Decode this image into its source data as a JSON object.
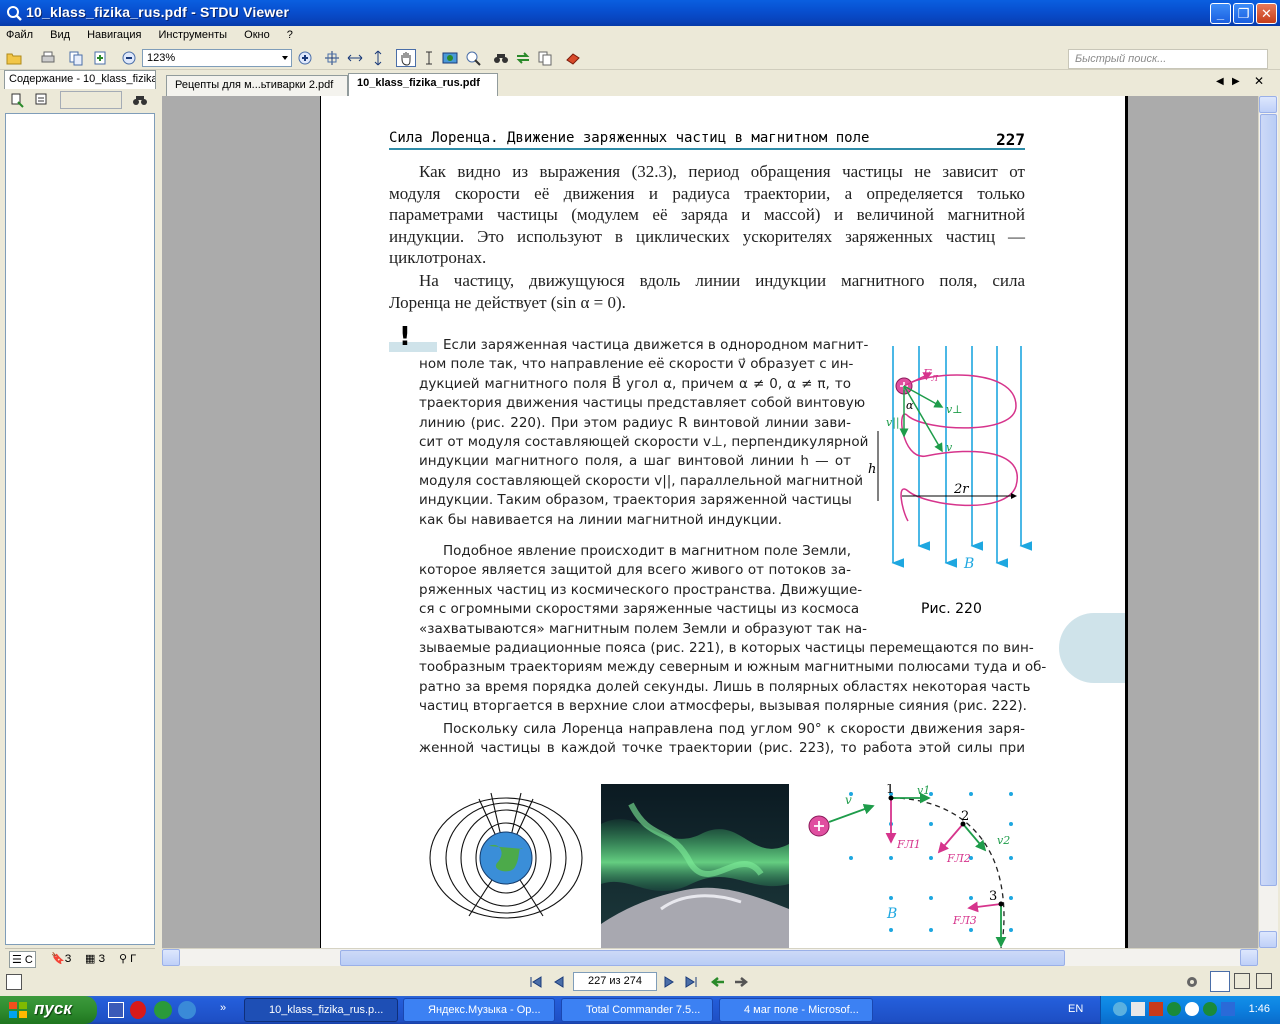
{
  "window": {
    "title": "10_klass_fizika_rus.pdf - STDU Viewer"
  },
  "menu": [
    "Файл",
    "Вид",
    "Навигация",
    "Инструменты",
    "Окно",
    "?"
  ],
  "toolbar": {
    "zoom": "123%",
    "search_placeholder": "Быстрый поиск..."
  },
  "sidebar": {
    "tab_label": "Содержание - 10_klass_fizika",
    "bottom_tabs": [
      "С",
      "З",
      "З",
      "Г"
    ]
  },
  "tabs": [
    {
      "label": "Рецепты для м...ьтиварки 2.pdf",
      "active": false
    },
    {
      "label": "10_klass_fizika_rus.pdf",
      "active": true
    }
  ],
  "page": {
    "header": "Сила Лоренца. Движение заряженных частиц в магнитном поле",
    "number": "227",
    "para1": [
      "Как видно из выражения (32.3), период обращения частицы не зависит от",
      "модуля скорости её движения и радиуса траектории, а определяется только",
      "параметрами частицы (модулем её заряда и массой) и величиной магнитной",
      "индукции. Это используют в циклических ускорителях заряженных частиц —",
      "циклотронах."
    ],
    "para2": [
      "На частицу, движущуюся вдоль линии индукции магнитного поля, сила",
      "Лоренца не действует (sin α = 0)."
    ],
    "note": [
      "Если заряженная частица движется в однородном магнит-",
      "ном поле так, что направление её скорости v⃗ образует с ин-",
      "дукцией магнитного поля B⃗ угол α, причем α ≠ 0, α ≠ π, то",
      "траектория движения частицы представляет собой винтовую",
      "линию (рис. 220). При этом радиус R винтовой линии зави-",
      "сит от модуля составляющей скорости v⊥, перпендикулярной",
      "индукции магнитного поля, а шаг винтовой линии h — от",
      "модуля составляющей скорости v||, параллельной магнитной",
      "индукции. Таким образом, траектория заряженной частицы",
      "как бы навивается на линии магнитной индукции."
    ],
    "para3_narrow": [
      "Подобное явление происходит в магнитном поле Земли,",
      "которое является защитой для всего живого от потоков за-",
      "ряженных частиц из космического пространства. Движущие-",
      "ся с огромными скоростями заряженные частицы из космоса",
      "«захватываются» магнитным полем Земли и образуют так на-"
    ],
    "para3_wide": [
      "зываемые радиационные пояса (рис. 221), в которых частицы перемещаются по вин-",
      "тообразным траекториям между северным и южным магнитными полюсами туда и об-",
      "ратно за время порядка долей секунды. Лишь в полярных областях некоторая часть",
      "частиц вторгается в верхние слои атмосферы, вызывая полярные сияния (рис. 222)."
    ],
    "para4": [
      "Поскольку сила Лоренца направлена под углом 90° к скорости движения заря-",
      "женной частицы в каждой точке траектории (рис. 223), то работа этой силы при"
    ],
    "fig220_caption": "Рис. 220",
    "fig220_labels": {
      "F": "F",
      "Fsub": "Л",
      "alpha": "α",
      "vperp": "v⊥",
      "vpar": "v||",
      "v": "v",
      "h": "h",
      "r": "2r",
      "B": "B"
    },
    "fig223_labels": {
      "p1": "1",
      "p2": "2",
      "p3": "3",
      "v": "v",
      "v1": "v1",
      "v2": "v2",
      "F1": "FЛ1",
      "F2": "FЛ2",
      "F3": "FЛ3",
      "B": "B"
    }
  },
  "navigation": {
    "page_indicator": "227 из 274"
  },
  "taskbar": {
    "start": "пуск",
    "tasks": [
      {
        "label": "10_klass_fizika_rus.p...",
        "active": true
      },
      {
        "label": "Яндекс.Музыка - Op...",
        "active": false
      },
      {
        "label": "Total Commander 7.5...",
        "active": false
      },
      {
        "label": "4 маг поле - Microsof...",
        "active": false
      }
    ],
    "lang": "EN",
    "clock": "1:46"
  },
  "colors": {
    "accent": "#2f8ca8",
    "field_lines": "#1ea7e0",
    "trajectory": "#d6348c",
    "vector_green": "#1e9c4a"
  }
}
